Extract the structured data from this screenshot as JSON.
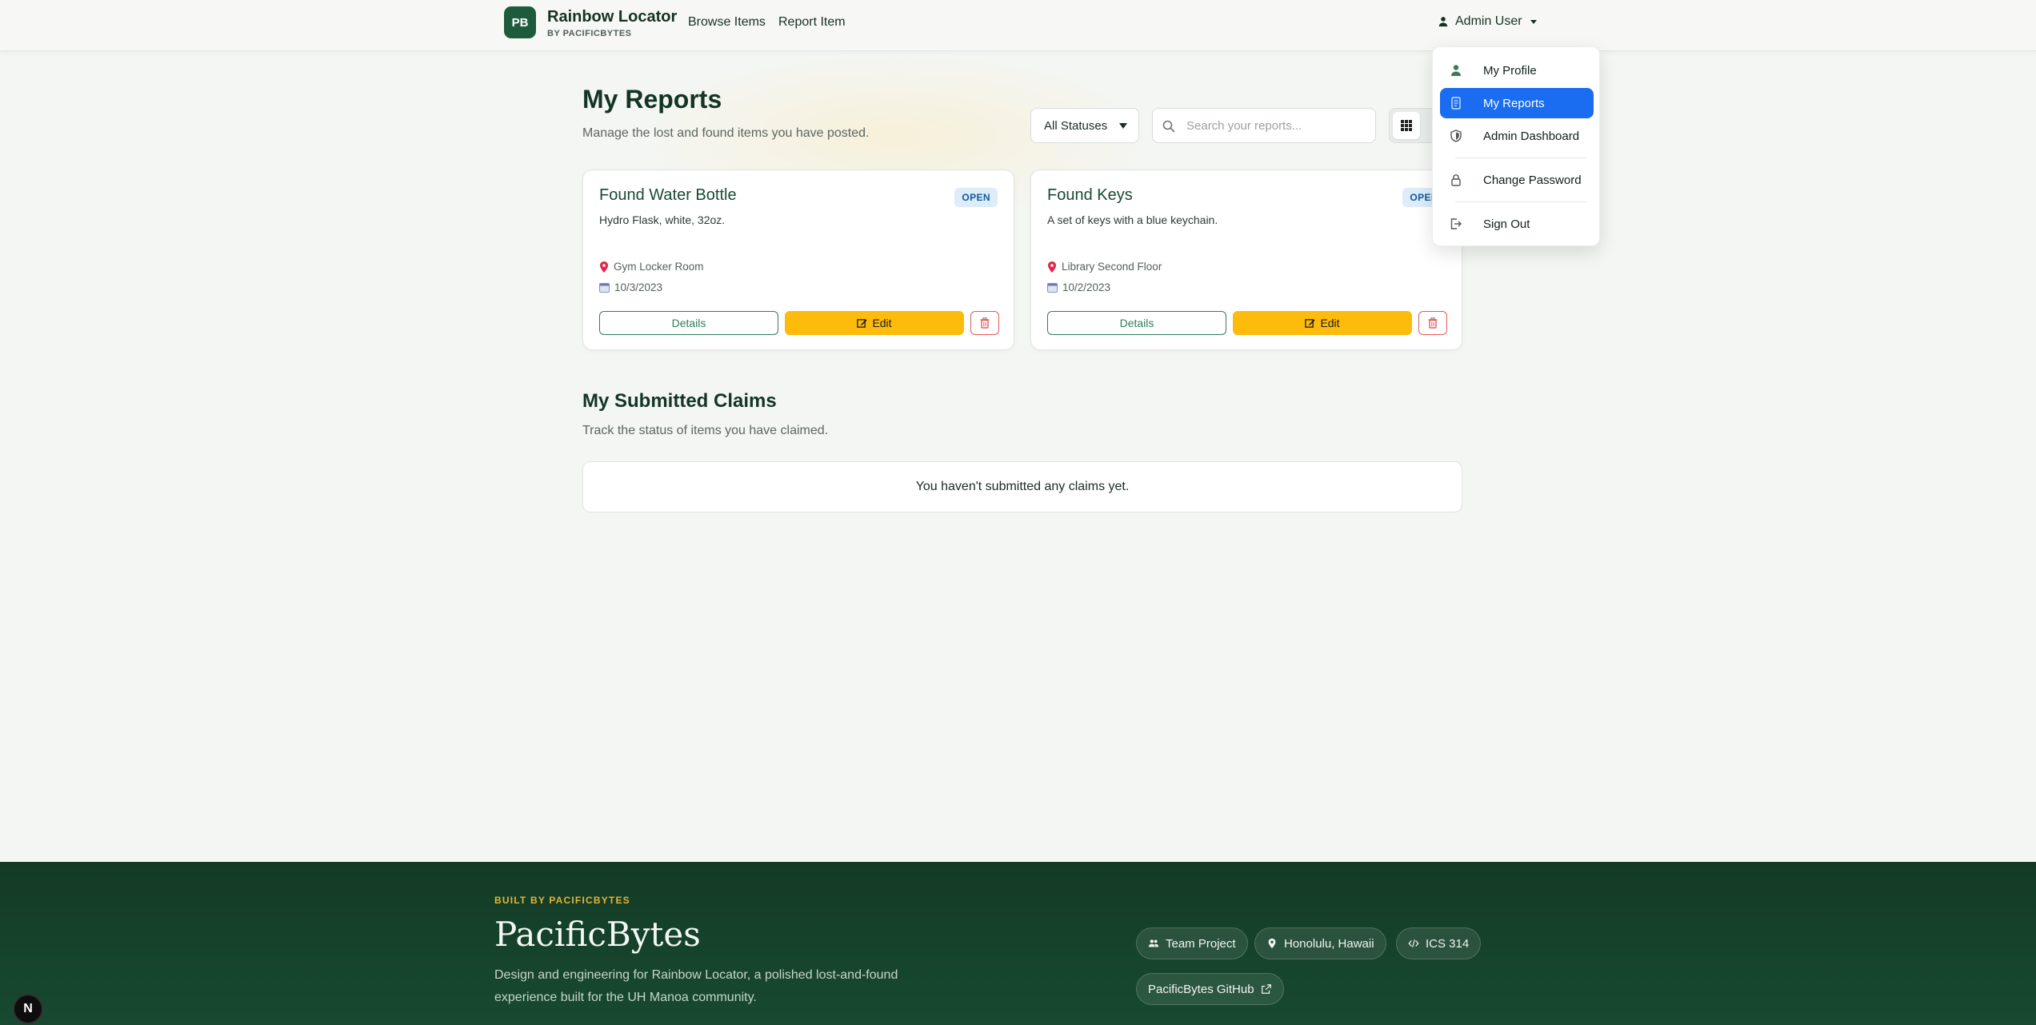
{
  "navbar": {
    "brand_initials": "PB",
    "brand_title": "Rainbow Locator",
    "brand_subtitle": "BY PACIFICBYTES",
    "links": [
      "Browse Items",
      "Report Item"
    ],
    "user_label": "Admin User"
  },
  "page": {
    "title": "My Reports",
    "subtitle": "Manage the lost and found items you have posted.",
    "status_filter": "All Statuses",
    "search_placeholder": "Search your reports..."
  },
  "reports": [
    {
      "title": "Found Water Bottle",
      "status": "OPEN",
      "description": "Hydro Flask, white, 32oz.",
      "location": "Gym Locker Room",
      "date": "10/3/2023"
    },
    {
      "title": "Found Keys",
      "status": "OPEN",
      "description": "A set of keys with a blue keychain.",
      "location": "Library Second Floor",
      "date": "10/2/2023"
    }
  ],
  "card_actions": {
    "details": "Details",
    "edit": "Edit"
  },
  "claims": {
    "title": "My Submitted Claims",
    "subtitle": "Track the status of items you have claimed.",
    "empty_message": "You haven't submitted any claims yet."
  },
  "dropdown": {
    "items": [
      {
        "label": "My Profile",
        "icon": "person-icon"
      },
      {
        "label": "My Reports",
        "icon": "document-icon",
        "active": true
      },
      {
        "label": "Admin Dashboard",
        "icon": "shield-icon"
      },
      {
        "label": "Change Password",
        "icon": "lock-icon"
      },
      {
        "label": "Sign Out",
        "icon": "sign-out-icon"
      }
    ]
  },
  "footer": {
    "kicker": "BUILT BY PACIFICBYTES",
    "title": "PacificBytes",
    "description": "Design and engineering for Rainbow Locator, a polished lost-and-found experience built for the UH Manoa community.",
    "pills": [
      "Team Project",
      "Honolulu, Hawaii",
      "ICS 314",
      "PacificBytes GitHub"
    ]
  },
  "colors": {
    "brand_green": "#1e5b3d",
    "edit_yellow": "#fdbb0b",
    "active_blue": "#1a6cf0",
    "footer_green": "#143a26",
    "footer_accent": "#e8b434"
  }
}
